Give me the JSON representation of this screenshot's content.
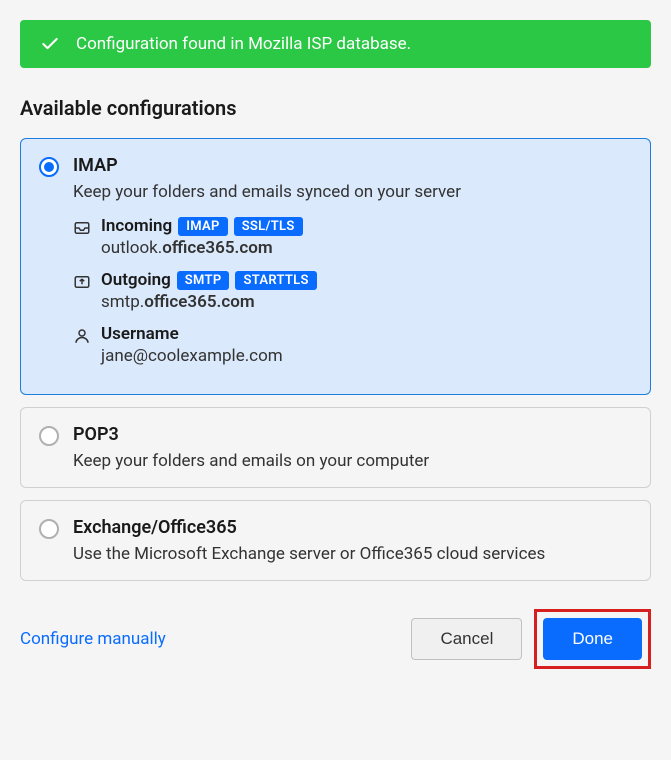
{
  "banner": {
    "message": "Configuration found in Mozilla ISP database."
  },
  "heading": "Available configurations",
  "configs": [
    {
      "id": "imap",
      "title": "IMAP",
      "description": "Keep your folders and emails synced on your server",
      "selected": true,
      "incoming": {
        "label": "Incoming",
        "protocol_badge": "IMAP",
        "security_badge": "SSL/TLS",
        "host_prefix": "outlook.",
        "host_bold": "office365.com"
      },
      "outgoing": {
        "label": "Outgoing",
        "protocol_badge": "SMTP",
        "security_badge": "STARTTLS",
        "host_prefix": "smtp.",
        "host_bold": "office365.com"
      },
      "username": {
        "label": "Username",
        "value": "jane@coolexample.com"
      }
    },
    {
      "id": "pop3",
      "title": "POP3",
      "description": "Keep your folders and emails on your computer",
      "selected": false
    },
    {
      "id": "exchange",
      "title": "Exchange/Office365",
      "description": "Use the Microsoft Exchange server or Office365 cloud services",
      "selected": false
    }
  ],
  "footer": {
    "configure_manually": "Configure manually",
    "cancel": "Cancel",
    "done": "Done"
  }
}
